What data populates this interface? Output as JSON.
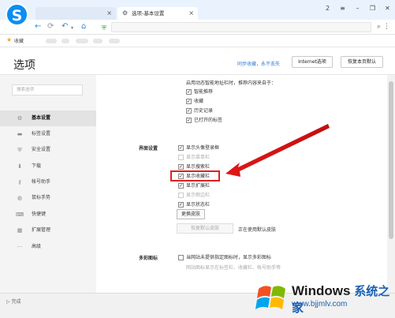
{
  "browser": {
    "tab_inactive_title": "",
    "tab_active_title": "选项-基本设置",
    "bookmarks_label": "收藏",
    "win_controls": [
      "2",
      "≡",
      "–",
      "❐",
      "✕"
    ]
  },
  "page": {
    "title": "选项",
    "sync_link": "同步收藏，永不丢失",
    "internet_options": "Internet选项",
    "restore_default": "恢复本页默认"
  },
  "sidebar": {
    "search_placeholder": "搜索选项",
    "items": [
      {
        "label": "基本设置",
        "icon": "gear-icon",
        "active": true
      },
      {
        "label": "标签设置",
        "icon": "tab-icon",
        "active": false
      },
      {
        "label": "安全设置",
        "icon": "shield-icon",
        "active": false
      },
      {
        "label": "下载",
        "icon": "download-icon",
        "active": false
      },
      {
        "label": "帐号助手",
        "icon": "key-icon",
        "active": false
      },
      {
        "label": "鼠标手势",
        "icon": "mouse-icon",
        "active": false
      },
      {
        "label": "快捷键",
        "icon": "keyboard-icon",
        "active": false
      },
      {
        "label": "扩展管理",
        "icon": "grid-icon",
        "active": false
      },
      {
        "label": "高级",
        "icon": "more-icon",
        "active": false
      }
    ]
  },
  "smart_address": {
    "intro": "启用动态智能地址栏时，推荐内容来自于：",
    "options": [
      {
        "label": "智能推荐",
        "checked": true
      },
      {
        "label": "收藏",
        "checked": true
      },
      {
        "label": "历史记录",
        "checked": true
      },
      {
        "label": "已打开的标签",
        "checked": true
      }
    ]
  },
  "interface": {
    "label": "界面设置",
    "options": [
      {
        "label": "显示头像登录框",
        "checked": true,
        "dim": false
      },
      {
        "label": "显示菜单栏",
        "checked": false,
        "dim": true
      },
      {
        "label": "显示搜索栏",
        "checked": true,
        "dim": false
      },
      {
        "label": "显示收藏栏",
        "checked": true,
        "dim": false
      },
      {
        "label": "显示扩展栏",
        "checked": true,
        "dim": false
      },
      {
        "label": "显示侧边栏",
        "checked": false,
        "dim": true
      },
      {
        "label": "显示状态栏",
        "checked": true,
        "dim": false
      }
    ],
    "change_skin": "更换皮肤",
    "restore_skin": "恢复默认皮肤",
    "skin_status": "正在使用默认皮肤"
  },
  "multicolor": {
    "label": "多彩图标",
    "option": "当网站未提供指定图标时，显示多彩图标",
    "note": "网站图标显示在标签栏、收藏栏、帐号助手等"
  },
  "statusbar": {
    "text": "完成"
  },
  "watermark": {
    "title": "Windows",
    "title_cn": "系统之家",
    "url": "www.bjjmlv.com"
  },
  "colors": {
    "accent": "#0b8ef2",
    "highlight_red": "#e02020",
    "link_blue": "#2f7fd6"
  }
}
